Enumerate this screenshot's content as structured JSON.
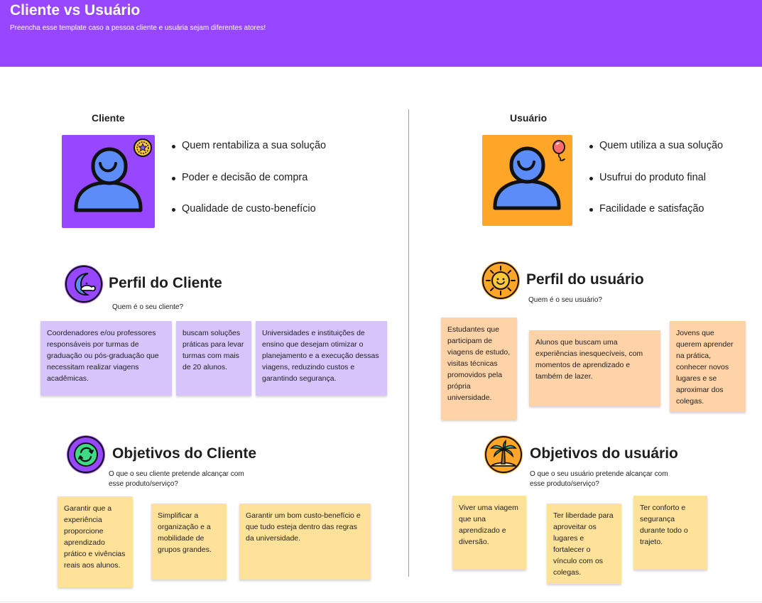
{
  "header": {
    "title": "Cliente vs Usuário",
    "subtitle": "Preencha esse template caso a pessoa cliente e usuária sejam diferentes atores!"
  },
  "cliente": {
    "label": "Cliente",
    "card_color": "#9747ff",
    "badge_icon": "star-coin-icon",
    "bullets": [
      "Quem rentabiliza a sua solução",
      "Poder e decisão de compra",
      "Qualidade de custo-benefício"
    ],
    "perfil": {
      "icon": "moon-icon",
      "title": "Perfil do Cliente",
      "subtitle": "Quem é o seu cliente?",
      "notes": [
        "Coordenadores e/ou professores responsáveis por turmas de graduação ou pós-graduação que necessitam realizar viagens acadêmicas.",
        "buscam soluções práticas para levar turmas com mais de 20 alunos.",
        "Universidades e instituições de ensino que desejam otimizar o planejamento e a execução dessas viagens, reduzindo custos e garantindo segurança."
      ]
    },
    "objetivos": {
      "icon": "refresh-arrows-icon",
      "title": "Objetivos do Cliente",
      "subtitle": "O que o seu cliente pretende alcançar com esse produto/serviço?",
      "notes": [
        "Garantir que a experiência proporcione aprendizado prático e vivências reais aos alunos.",
        "Simplificar a organização e a mobilidade de grupos grandes.",
        "Garantir um bom custo-benefício e que tudo esteja dentro das regras da universidade."
      ]
    }
  },
  "usuario": {
    "label": "Usuário",
    "card_color": "#ffa629",
    "badge_icon": "balloon-icon",
    "bullets": [
      "Quem utiliza a sua solução",
      "Usufrui do produto final",
      "Facilidade e satisfação"
    ],
    "perfil": {
      "icon": "sun-icon",
      "title": "Perfil do usuário",
      "subtitle": "Quem é o seu usuário?",
      "notes": [
        "Estudantes que participam de viagens de estudo, visitas técnicas promovidos pela própria universidade.",
        "Alunos que buscam uma experiências inesquecíveis, com momentos de aprendizado e também de lazer.",
        "Jovens que querem aprender na prática, conhecer novos lugares e se aproximar dos colegas."
      ]
    },
    "objetivos": {
      "icon": "palm-tree-icon",
      "title": "Objetivos do usuário",
      "subtitle": "O que o seu usuário pretende alcançar com esse produto/serviço?",
      "notes": [
        "Viver uma viagem que una aprendizado e diversão.",
        "Ter liberdade para aproveitar os lugares e fortalecer o vínculo com os colegas.",
        "Ter conforto e segurança durante todo o trajeto."
      ]
    }
  },
  "colors": {
    "header": "#9747ff",
    "violet_note": "#d6c4fb",
    "orange_note": "#ffd3a8",
    "yellow_note": "#ffe29a"
  }
}
